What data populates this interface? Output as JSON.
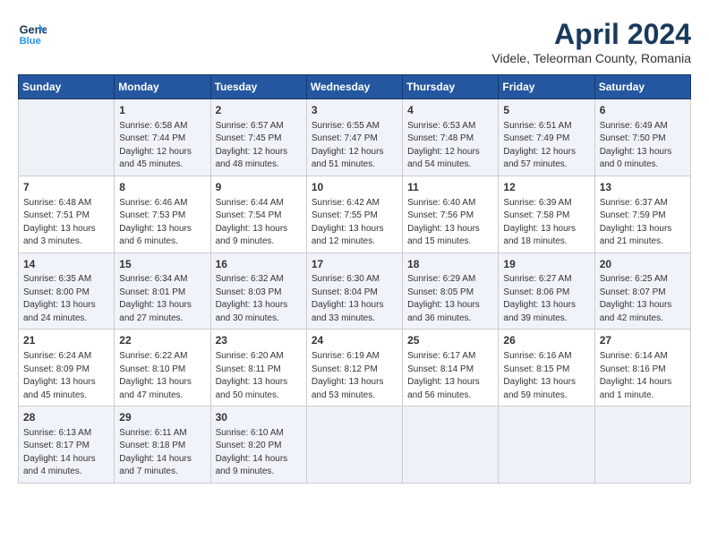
{
  "header": {
    "logo_line1": "General",
    "logo_line2": "Blue",
    "month_year": "April 2024",
    "location": "Videle, Teleorman County, Romania"
  },
  "weekdays": [
    "Sunday",
    "Monday",
    "Tuesday",
    "Wednesday",
    "Thursday",
    "Friday",
    "Saturday"
  ],
  "weeks": [
    [
      {
        "day": "",
        "info": ""
      },
      {
        "day": "1",
        "info": "Sunrise: 6:58 AM\nSunset: 7:44 PM\nDaylight: 12 hours\nand 45 minutes."
      },
      {
        "day": "2",
        "info": "Sunrise: 6:57 AM\nSunset: 7:45 PM\nDaylight: 12 hours\nand 48 minutes."
      },
      {
        "day": "3",
        "info": "Sunrise: 6:55 AM\nSunset: 7:47 PM\nDaylight: 12 hours\nand 51 minutes."
      },
      {
        "day": "4",
        "info": "Sunrise: 6:53 AM\nSunset: 7:48 PM\nDaylight: 12 hours\nand 54 minutes."
      },
      {
        "day": "5",
        "info": "Sunrise: 6:51 AM\nSunset: 7:49 PM\nDaylight: 12 hours\nand 57 minutes."
      },
      {
        "day": "6",
        "info": "Sunrise: 6:49 AM\nSunset: 7:50 PM\nDaylight: 13 hours\nand 0 minutes."
      }
    ],
    [
      {
        "day": "7",
        "info": "Sunrise: 6:48 AM\nSunset: 7:51 PM\nDaylight: 13 hours\nand 3 minutes."
      },
      {
        "day": "8",
        "info": "Sunrise: 6:46 AM\nSunset: 7:53 PM\nDaylight: 13 hours\nand 6 minutes."
      },
      {
        "day": "9",
        "info": "Sunrise: 6:44 AM\nSunset: 7:54 PM\nDaylight: 13 hours\nand 9 minutes."
      },
      {
        "day": "10",
        "info": "Sunrise: 6:42 AM\nSunset: 7:55 PM\nDaylight: 13 hours\nand 12 minutes."
      },
      {
        "day": "11",
        "info": "Sunrise: 6:40 AM\nSunset: 7:56 PM\nDaylight: 13 hours\nand 15 minutes."
      },
      {
        "day": "12",
        "info": "Sunrise: 6:39 AM\nSunset: 7:58 PM\nDaylight: 13 hours\nand 18 minutes."
      },
      {
        "day": "13",
        "info": "Sunrise: 6:37 AM\nSunset: 7:59 PM\nDaylight: 13 hours\nand 21 minutes."
      }
    ],
    [
      {
        "day": "14",
        "info": "Sunrise: 6:35 AM\nSunset: 8:00 PM\nDaylight: 13 hours\nand 24 minutes."
      },
      {
        "day": "15",
        "info": "Sunrise: 6:34 AM\nSunset: 8:01 PM\nDaylight: 13 hours\nand 27 minutes."
      },
      {
        "day": "16",
        "info": "Sunrise: 6:32 AM\nSunset: 8:03 PM\nDaylight: 13 hours\nand 30 minutes."
      },
      {
        "day": "17",
        "info": "Sunrise: 6:30 AM\nSunset: 8:04 PM\nDaylight: 13 hours\nand 33 minutes."
      },
      {
        "day": "18",
        "info": "Sunrise: 6:29 AM\nSunset: 8:05 PM\nDaylight: 13 hours\nand 36 minutes."
      },
      {
        "day": "19",
        "info": "Sunrise: 6:27 AM\nSunset: 8:06 PM\nDaylight: 13 hours\nand 39 minutes."
      },
      {
        "day": "20",
        "info": "Sunrise: 6:25 AM\nSunset: 8:07 PM\nDaylight: 13 hours\nand 42 minutes."
      }
    ],
    [
      {
        "day": "21",
        "info": "Sunrise: 6:24 AM\nSunset: 8:09 PM\nDaylight: 13 hours\nand 45 minutes."
      },
      {
        "day": "22",
        "info": "Sunrise: 6:22 AM\nSunset: 8:10 PM\nDaylight: 13 hours\nand 47 minutes."
      },
      {
        "day": "23",
        "info": "Sunrise: 6:20 AM\nSunset: 8:11 PM\nDaylight: 13 hours\nand 50 minutes."
      },
      {
        "day": "24",
        "info": "Sunrise: 6:19 AM\nSunset: 8:12 PM\nDaylight: 13 hours\nand 53 minutes."
      },
      {
        "day": "25",
        "info": "Sunrise: 6:17 AM\nSunset: 8:14 PM\nDaylight: 13 hours\nand 56 minutes."
      },
      {
        "day": "26",
        "info": "Sunrise: 6:16 AM\nSunset: 8:15 PM\nDaylight: 13 hours\nand 59 minutes."
      },
      {
        "day": "27",
        "info": "Sunrise: 6:14 AM\nSunset: 8:16 PM\nDaylight: 14 hours\nand 1 minute."
      }
    ],
    [
      {
        "day": "28",
        "info": "Sunrise: 6:13 AM\nSunset: 8:17 PM\nDaylight: 14 hours\nand 4 minutes."
      },
      {
        "day": "29",
        "info": "Sunrise: 6:11 AM\nSunset: 8:18 PM\nDaylight: 14 hours\nand 7 minutes."
      },
      {
        "day": "30",
        "info": "Sunrise: 6:10 AM\nSunset: 8:20 PM\nDaylight: 14 hours\nand 9 minutes."
      },
      {
        "day": "",
        "info": ""
      },
      {
        "day": "",
        "info": ""
      },
      {
        "day": "",
        "info": ""
      },
      {
        "day": "",
        "info": ""
      }
    ]
  ]
}
